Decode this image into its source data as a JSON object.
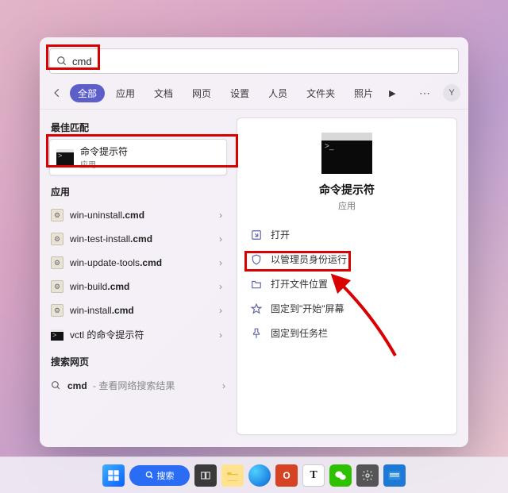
{
  "search": {
    "query": "cmd"
  },
  "tabs": {
    "all": "全部",
    "apps": "应用",
    "docs": "文档",
    "web": "网页",
    "settings": "设置",
    "people": "人员",
    "folders": "文件夹",
    "photos": "照片"
  },
  "avatar_initial": "Y",
  "left": {
    "best_label": "最佳匹配",
    "best": {
      "title": "命令提示符",
      "sub": "应用"
    },
    "apps_label": "应用",
    "apps": [
      {
        "name_pre": "win-uninstall",
        "name_ext": ".cmd"
      },
      {
        "name_pre": "win-test-install",
        "name_ext": ".cmd"
      },
      {
        "name_pre": "win-update-tools",
        "name_ext": ".cmd"
      },
      {
        "name_pre": "win-build",
        "name_ext": ".cmd"
      },
      {
        "name_pre": "win-install",
        "name_ext": ".cmd"
      },
      {
        "name_pre": "vctl 的命令提示符",
        "name_ext": ""
      }
    ],
    "web_label": "搜索网页",
    "web_query": "cmd",
    "web_sub": " - 查看网络搜索结果"
  },
  "right": {
    "title": "命令提示符",
    "sub": "应用",
    "actions": {
      "open": "打开",
      "admin": "以管理员身份运行",
      "location": "打开文件位置",
      "pin_start": "固定到\"开始\"屏幕",
      "pin_taskbar": "固定到任务栏"
    }
  },
  "taskbar": {
    "search_label": "搜索"
  }
}
